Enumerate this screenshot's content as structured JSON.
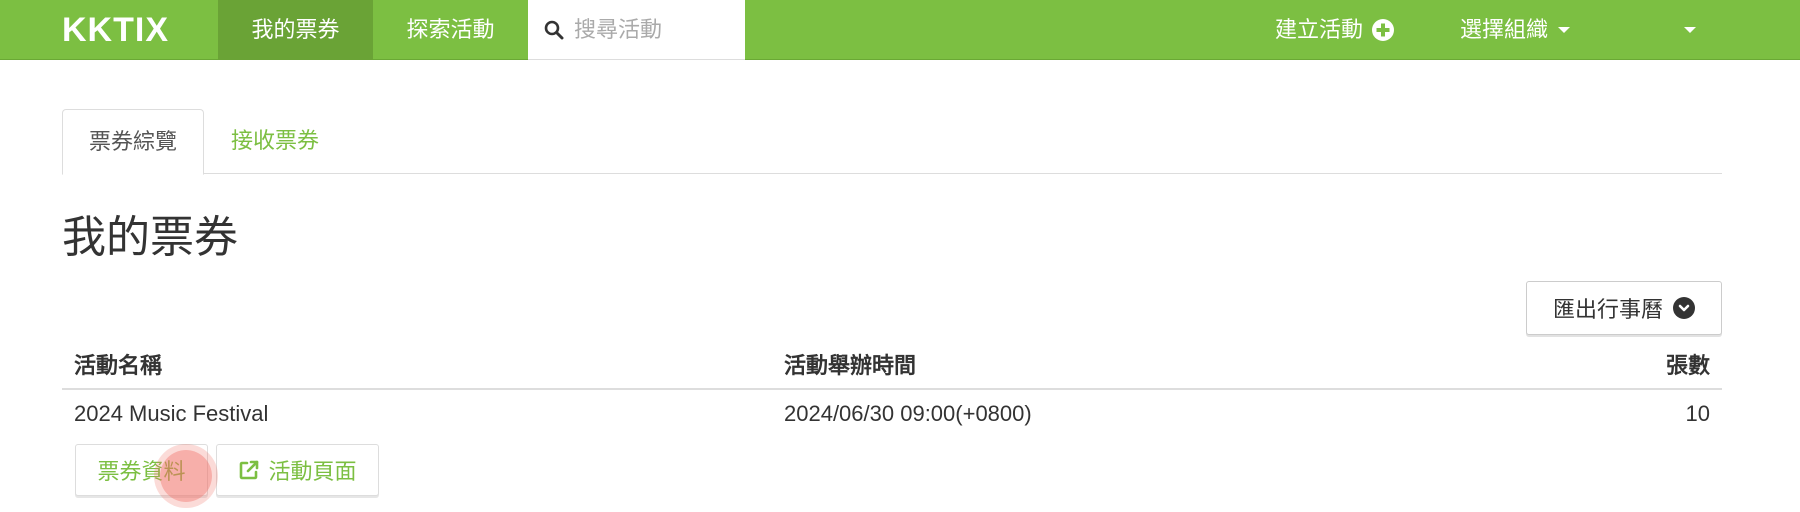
{
  "navbar": {
    "brand": "KKTIX",
    "my_tickets": "我的票券",
    "explore": "探索活動",
    "search_placeholder": "搜尋活動",
    "create_event": "建立活動",
    "select_org": "選擇組織"
  },
  "tabs": {
    "overview": "票券綜覽",
    "receive": "接收票券"
  },
  "page": {
    "title": "我的票券",
    "export_calendar": "匯出行事曆"
  },
  "table": {
    "headers": {
      "name": "活動名稱",
      "time": "活動舉辦時間",
      "qty": "張數"
    },
    "rows": [
      {
        "name": "2024 Music Festival",
        "time": "2024/06/30 09:00(+0800)",
        "qty": "10",
        "ticket_info_label": "票券資料",
        "event_page_label": "活動頁面"
      }
    ]
  },
  "colors": {
    "brand_green": "#7cbf42",
    "nav_active": "#6aa336"
  },
  "icons": {
    "search": "search-icon",
    "create": "plus-circle-icon",
    "caret": "caret-down-icon",
    "export": "chevron-circle-down-icon",
    "external": "external-link-icon"
  }
}
